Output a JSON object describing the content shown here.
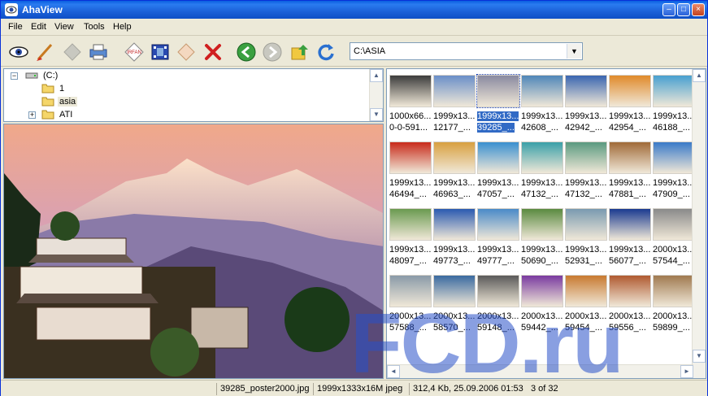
{
  "window": {
    "title": "AhaView"
  },
  "menu": [
    "File",
    "Edit",
    "View",
    "Tools",
    "Help"
  ],
  "address": {
    "value": "C:\\ASIA"
  },
  "tree": [
    {
      "label": "(C:)",
      "level": 0,
      "expander": "−"
    },
    {
      "label": "1",
      "level": 1
    },
    {
      "label": "asia",
      "level": 1,
      "selected": true
    },
    {
      "label": "ATI",
      "level": 1,
      "expander": "+"
    }
  ],
  "thumbnails": {
    "rows": [
      [
        {
          "l1": "1000x66...",
          "l2": "0-0-591..."
        },
        {
          "l1": "1999x13...",
          "l2": "12177_..."
        },
        {
          "l1": "1999x13...",
          "l2": "39285_...",
          "selected": true
        },
        {
          "l1": "1999x13...",
          "l2": "42608_..."
        },
        {
          "l1": "1999x13...",
          "l2": "42942_..."
        },
        {
          "l1": "1999x13...",
          "l2": "42954_..."
        },
        {
          "l1": "1999x13...",
          "l2": "46188_..."
        }
      ],
      [
        {
          "l1": "1999x13...",
          "l2": "46494_..."
        },
        {
          "l1": "1999x13...",
          "l2": "46963_..."
        },
        {
          "l1": "1999x13...",
          "l2": "47057_..."
        },
        {
          "l1": "1999x13...",
          "l2": "47132_..."
        },
        {
          "l1": "1999x13...",
          "l2": "47132_..."
        },
        {
          "l1": "1999x13...",
          "l2": "47881_..."
        },
        {
          "l1": "1999x13...",
          "l2": "47909_..."
        }
      ],
      [
        {
          "l1": "1999x13...",
          "l2": "48097_..."
        },
        {
          "l1": "1999x13...",
          "l2": "49773_..."
        },
        {
          "l1": "1999x13...",
          "l2": "49777_..."
        },
        {
          "l1": "1999x13...",
          "l2": "50690_..."
        },
        {
          "l1": "1999x13...",
          "l2": "52931_..."
        },
        {
          "l1": "1999x13...",
          "l2": "56077_..."
        },
        {
          "l1": "2000x13...",
          "l2": "57544_..."
        }
      ],
      [
        {
          "l1": "2000x13...",
          "l2": "57588_..."
        },
        {
          "l1": "2000x13...",
          "l2": "58570_..."
        },
        {
          "l1": "2000x13...",
          "l2": "59148_..."
        },
        {
          "l1": "2000x13...",
          "l2": "59442_..."
        },
        {
          "l1": "2000x13...",
          "l2": "59454_..."
        },
        {
          "l1": "2000x13...",
          "l2": "59556_..."
        },
        {
          "l1": "2000x13...",
          "l2": "59899_..."
        }
      ]
    ],
    "colors": [
      [
        "#3c3c3c",
        "#6a8fc8",
        "#8a8aa0",
        "#4f86b8",
        "#3a66b0",
        "#e08a2a",
        "#48a0d0"
      ],
      [
        "#c82a1a",
        "#d8a040",
        "#3a90d0",
        "#3aa0a8",
        "#5a9a80",
        "#a06a38",
        "#3a7ac8"
      ],
      [
        "#6a9a50",
        "#2a5ab0",
        "#4a8ac8",
        "#5a8a40",
        "#7a9ab0",
        "#1a3a90",
        "#8a8a8a"
      ],
      [
        "#8a9aa8",
        "#3a6aa0",
        "#5a5a5a",
        "#7a3aa0",
        "#c87a30",
        "#b05a30",
        "#a07a50"
      ]
    ]
  },
  "status": [
    "39285_poster2000.jpg",
    "1999x1333x16M jpeg",
    "312,4 Kb, 25.09.2006 01:53",
    "3 of 32"
  ],
  "watermark": "FCD.ru"
}
